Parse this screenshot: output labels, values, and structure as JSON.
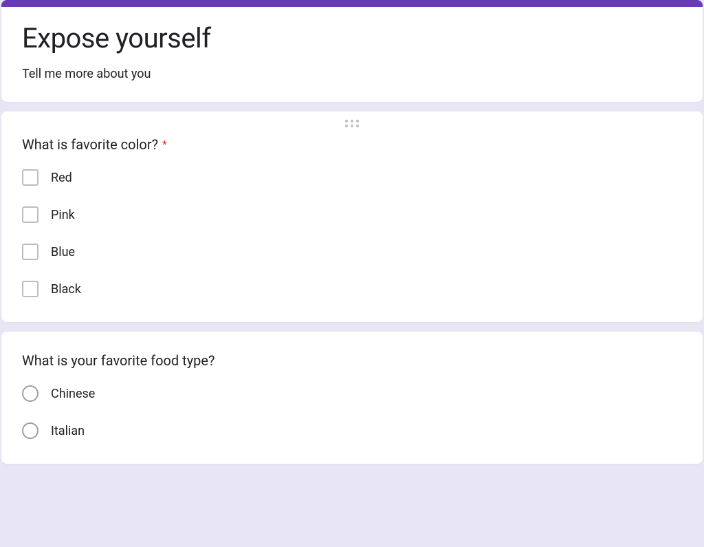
{
  "accent_color": "#673ab7",
  "required_color": "#d93025",
  "header": {
    "title": "Expose yourself",
    "description": "Tell me more about you"
  },
  "questions": [
    {
      "title": "What is favorite color?",
      "required": true,
      "type": "checkbox",
      "options": [
        "Red",
        "Pink",
        "Blue",
        "Black"
      ]
    },
    {
      "title": "What is your favorite food type?",
      "required": false,
      "type": "radio",
      "options": [
        "Chinese",
        "Italian"
      ]
    }
  ]
}
